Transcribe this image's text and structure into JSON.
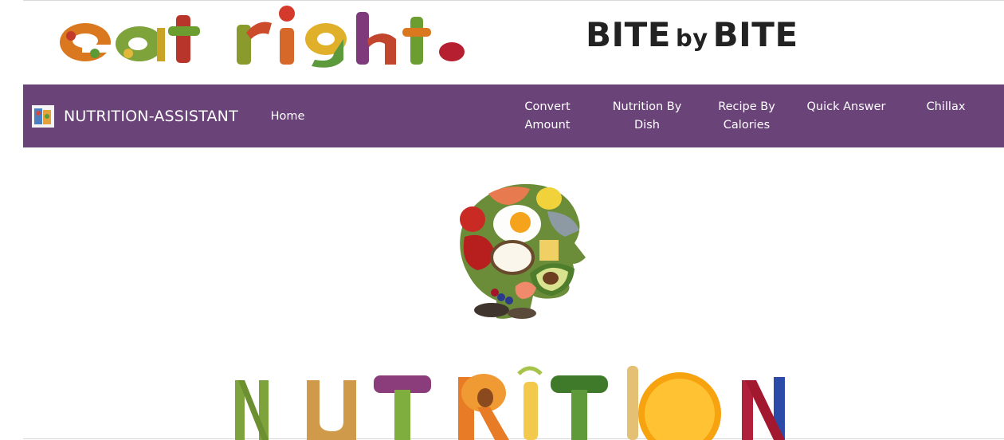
{
  "header": {
    "banner_alt": "eat right.",
    "title_part1": "BITE",
    "title_by": "by",
    "title_part2": "BITE"
  },
  "navbar": {
    "brand": "NUTRITION-ASSISTANT",
    "links": [
      {
        "line1": "Home",
        "line2": ""
      },
      {
        "line1": "Convert",
        "line2": "Amount"
      },
      {
        "line1": "Nutrition By",
        "line2": "Dish"
      },
      {
        "line1": "Recipe By",
        "line2": "Calories"
      },
      {
        "line1": "Quick Answer",
        "line2": ""
      },
      {
        "line1": "Chillax",
        "line2": ""
      }
    ]
  },
  "colors": {
    "nav_bg": "#6a4379",
    "title_text": "#222222"
  },
  "images": {
    "center": "food-head-illustration",
    "bottom": "nutrition-letters-illustration"
  }
}
